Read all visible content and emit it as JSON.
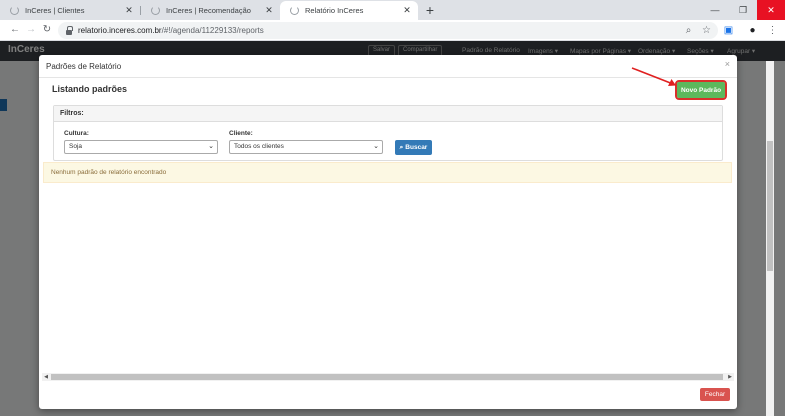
{
  "browser": {
    "tabs": [
      {
        "title": "InCeres | Clientes",
        "active": false
      },
      {
        "title": "InCeres | Recomendação",
        "active": false
      },
      {
        "title": "Relatório InCeres",
        "active": true
      }
    ],
    "url_host": "relatorio.inceres.com.br",
    "url_path": "/#!/agenda/11229133/reports"
  },
  "app": {
    "logo": "InCeres",
    "nav": [
      "Salvar",
      "Compartilhar",
      "Padrão de Relatório",
      "Imagens ▾",
      "Mapas por Páginas ▾",
      "Ordenação ▾",
      "Seções ▾",
      "Agrupar ▾"
    ]
  },
  "modal": {
    "title": "Padrões de Relatório",
    "listing_title": "Listando padrões",
    "new_button": "Novo Padrão",
    "filters_label": "Filtros:",
    "crop_label": "Cultura:",
    "crop_value": "Soja",
    "client_label": "Cliente:",
    "client_value": "Todos os clientes",
    "search_button": "Buscar",
    "empty_message": "Nenhum padrão de relatório encontrado",
    "close_button": "Fechar"
  },
  "colors": {
    "success": "#5cb85c",
    "primary": "#337ab7",
    "danger": "#d9534f",
    "highlight": "#d9302a"
  }
}
